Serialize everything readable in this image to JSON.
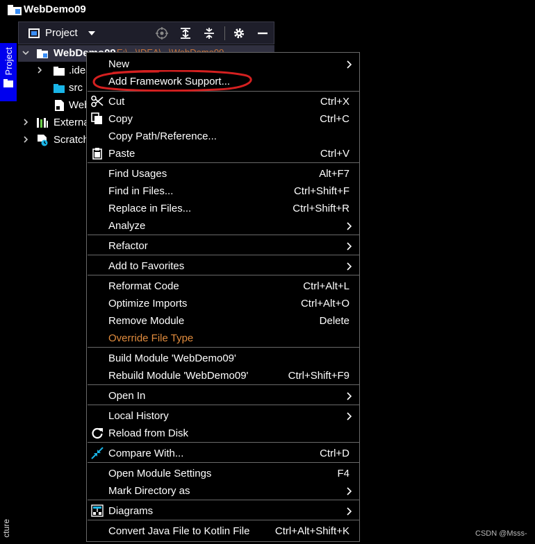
{
  "window": {
    "title": "WebDemo09"
  },
  "tool_strip": {
    "project_tab": "Project",
    "structure_tab": "cture"
  },
  "panel": {
    "header_label": "Project",
    "tree": [
      {
        "label": "WebDemo09",
        "hint": "E:\\...\\IDEA\\...\\WebDemo09"
      },
      {
        "label": ".idea"
      },
      {
        "label": "src"
      },
      {
        "label": "Web"
      },
      {
        "label": "External"
      },
      {
        "label": "Scratch"
      }
    ]
  },
  "menu": {
    "items": [
      {
        "label": "New",
        "shortcut": "",
        "submenu": true
      },
      {
        "label": "Add Framework Support...",
        "shortcut": "",
        "submenu": false
      },
      {
        "label": "Cut",
        "shortcut": "Ctrl+X",
        "submenu": false
      },
      {
        "label": "Copy",
        "shortcut": "Ctrl+C",
        "submenu": false
      },
      {
        "label": "Copy Path/Reference...",
        "shortcut": "",
        "submenu": false
      },
      {
        "label": "Paste",
        "shortcut": "Ctrl+V",
        "submenu": false
      },
      {
        "label": "Find Usages",
        "shortcut": "Alt+F7",
        "submenu": false
      },
      {
        "label": "Find in Files...",
        "shortcut": "Ctrl+Shift+F",
        "submenu": false
      },
      {
        "label": "Replace in Files...",
        "shortcut": "Ctrl+Shift+R",
        "submenu": false
      },
      {
        "label": "Analyze",
        "shortcut": "",
        "submenu": true
      },
      {
        "label": "Refactor",
        "shortcut": "",
        "submenu": true
      },
      {
        "label": "Add to Favorites",
        "shortcut": "",
        "submenu": true
      },
      {
        "label": "Reformat Code",
        "shortcut": "Ctrl+Alt+L",
        "submenu": false
      },
      {
        "label": "Optimize Imports",
        "shortcut": "Ctrl+Alt+O",
        "submenu": false
      },
      {
        "label": "Remove Module",
        "shortcut": "Delete",
        "submenu": false
      },
      {
        "label": "Override File Type",
        "shortcut": "",
        "submenu": false
      },
      {
        "label": "Build Module 'WebDemo09'",
        "shortcut": "",
        "submenu": false
      },
      {
        "label": "Rebuild Module 'WebDemo09'",
        "shortcut": "Ctrl+Shift+F9",
        "submenu": false
      },
      {
        "label": "Open In",
        "shortcut": "",
        "submenu": true
      },
      {
        "label": "Local History",
        "shortcut": "",
        "submenu": true
      },
      {
        "label": "Reload from Disk",
        "shortcut": "",
        "submenu": false
      },
      {
        "label": "Compare With...",
        "shortcut": "Ctrl+D",
        "submenu": false
      },
      {
        "label": "Open Module Settings",
        "shortcut": "F4",
        "submenu": false
      },
      {
        "label": "Mark Directory as",
        "shortcut": "",
        "submenu": true
      },
      {
        "label": "Diagrams",
        "shortcut": "",
        "submenu": true
      },
      {
        "label": "Convert Java File to Kotlin File",
        "shortcut": "Ctrl+Alt+Shift+K",
        "submenu": false
      }
    ]
  },
  "colors": {
    "accent": "#3a8ef6",
    "orange_item": "#e08b3d",
    "annotation_red": "#d42020",
    "tab_blue": "#0000ee"
  },
  "watermark": "CSDN @Msss-"
}
